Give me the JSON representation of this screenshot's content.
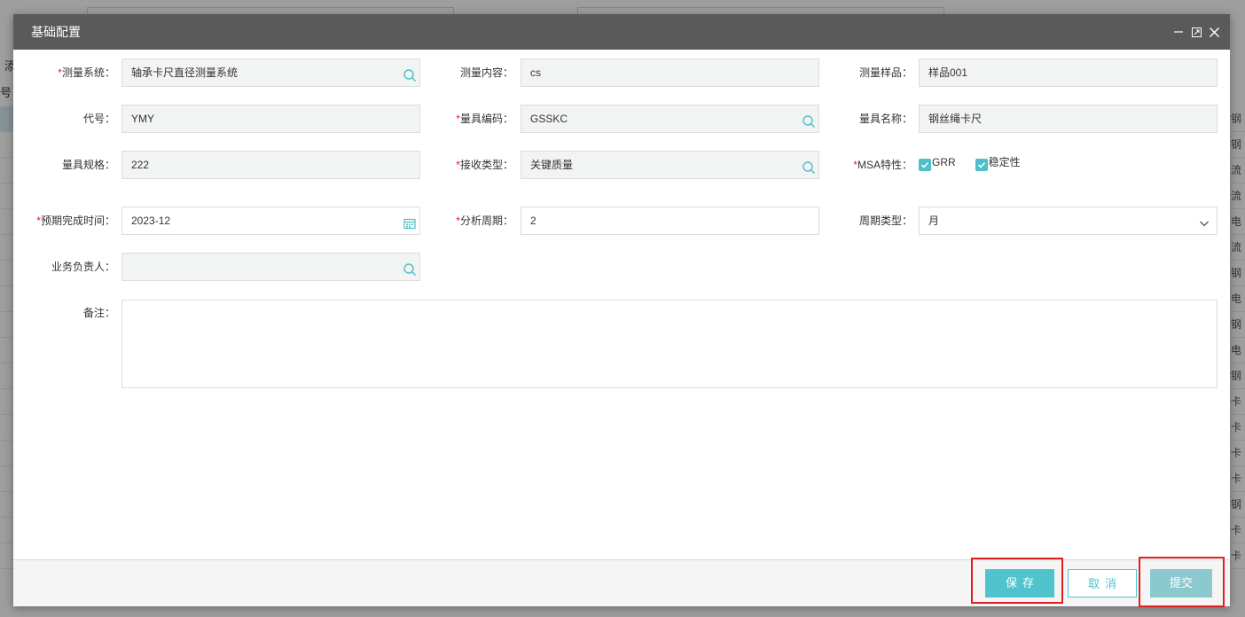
{
  "background": {
    "left_column": [
      "添",
      "号"
    ],
    "right_column": [
      "钢",
      "钢",
      "流",
      "流",
      "电",
      "流",
      "钢",
      "电",
      "钢",
      "电",
      "钢",
      "卡",
      "卡",
      "卡",
      "卡",
      "钢",
      "卡",
      "卡"
    ]
  },
  "dialog": {
    "title": "基础配置",
    "header_icons": [
      "minimize-icon",
      "maximize-icon",
      "close-icon"
    ]
  },
  "form": {
    "measure_system": {
      "label": "测量系统",
      "value": "轴承卡尺直径测量系统",
      "required": true,
      "icon": "search-icon"
    },
    "measure_content": {
      "label": "测量内容",
      "value": "cs"
    },
    "measure_sample": {
      "label": "测量样品",
      "value": "样品001"
    },
    "code": {
      "label": "代号",
      "value": "YMY"
    },
    "gauge_code": {
      "label": "量具编码",
      "value": "GSSKC",
      "required": true,
      "icon": "search-icon"
    },
    "gauge_name": {
      "label": "量具名称",
      "value": "钢丝绳卡尺"
    },
    "gauge_spec": {
      "label": "量具规格",
      "value": "222"
    },
    "receive_type": {
      "label": "接收类型",
      "value": "关键质量",
      "required": true,
      "icon": "search-icon"
    },
    "msa": {
      "label": "MSA特性",
      "required": true,
      "options": [
        {
          "label": "GRR",
          "checked": true
        },
        {
          "label": "稳定性",
          "checked": true
        }
      ]
    },
    "expected_time": {
      "label": "预期完成时间",
      "value": "2023-12",
      "required": true,
      "icon": "calendar-icon"
    },
    "analysis_period": {
      "label": "分析周期",
      "value": "2",
      "required": true
    },
    "period_type": {
      "label": "周期类型",
      "value": "月",
      "icon": "chevron-down-icon"
    },
    "owner": {
      "label": "业务负责人",
      "value": "",
      "icon": "search-icon"
    },
    "remark": {
      "label": "备注",
      "value": ""
    }
  },
  "buttons": {
    "save": "保存",
    "cancel": "取消",
    "submit": "提交"
  },
  "colors": {
    "accent": "#4fc4cc",
    "header": "#5a5a5a",
    "required": "#e02020",
    "highlight_box": "#e02020"
  }
}
